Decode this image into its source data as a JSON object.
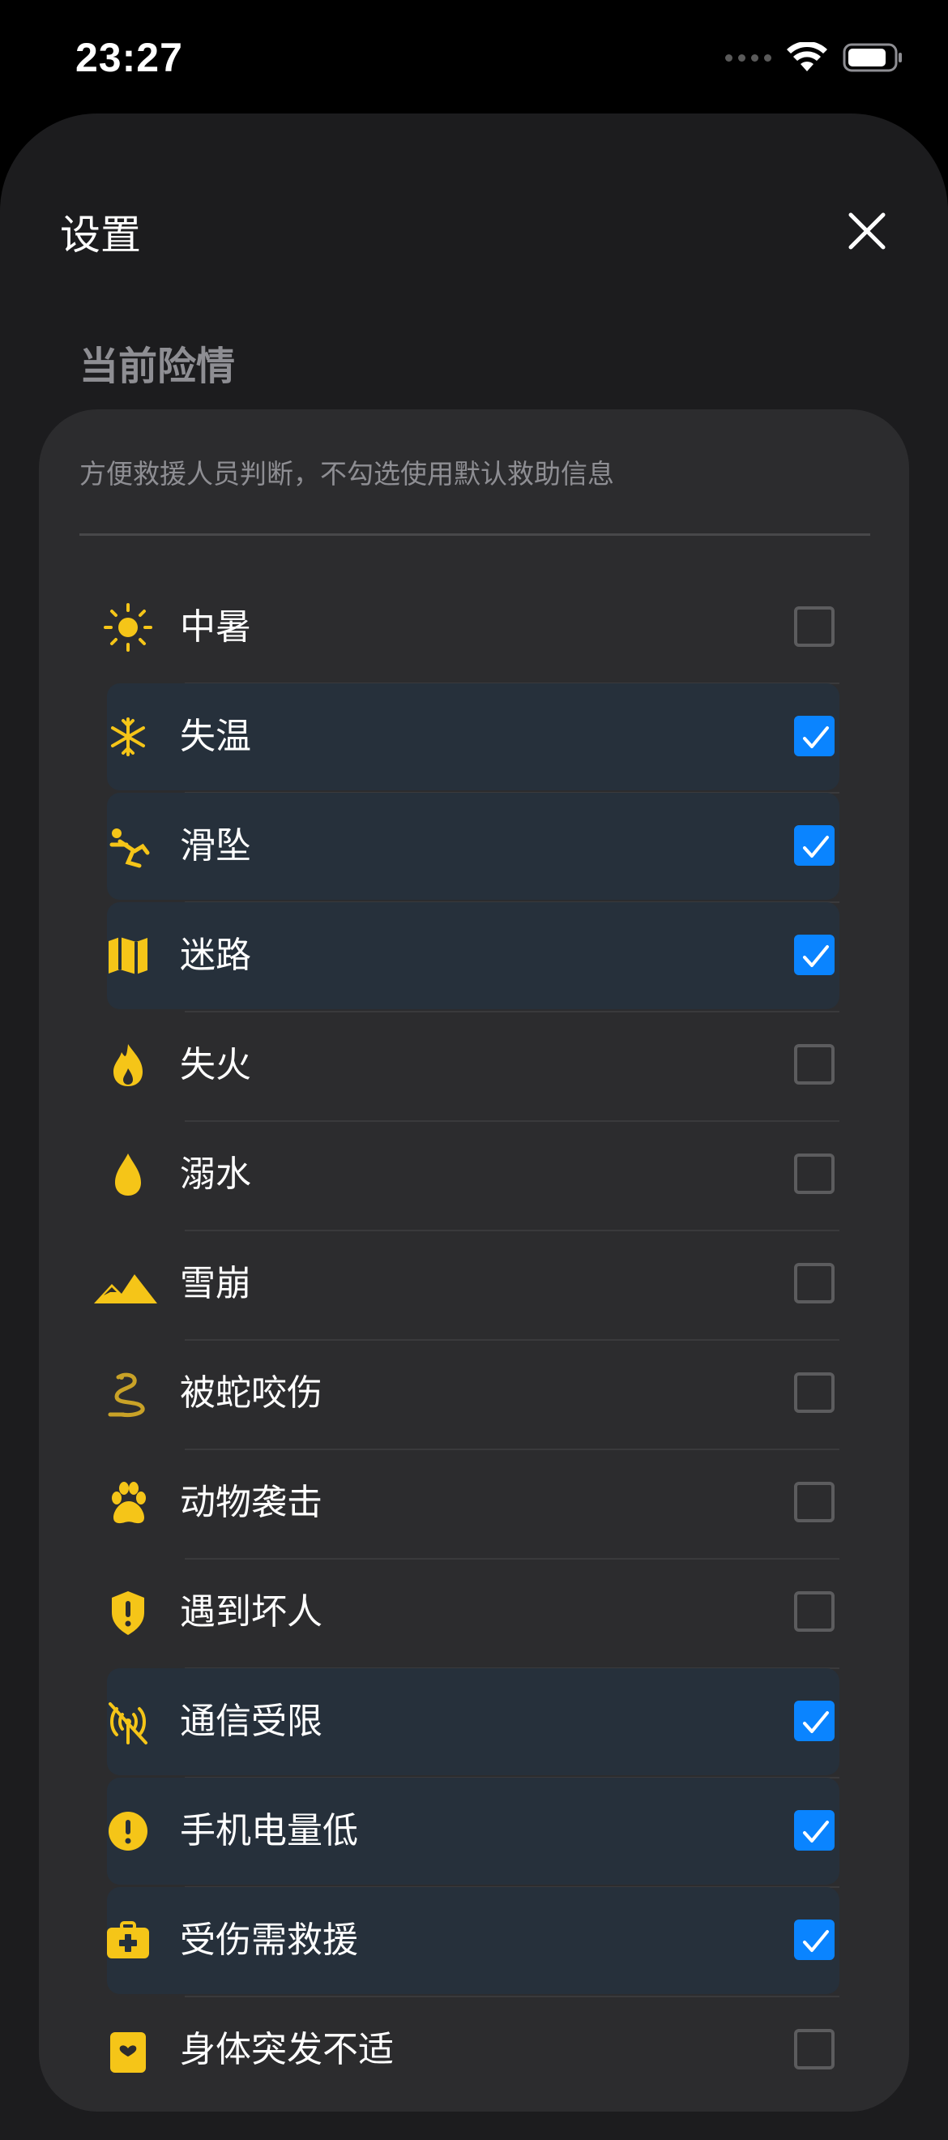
{
  "status_bar": {
    "time": "23:27"
  },
  "sheet": {
    "title": "设置",
    "section_title": "当前险情",
    "hint": "方便救援人员判断，不勾选使用默认救助信息"
  },
  "colors": {
    "accent": "#0a84ff",
    "icon": "#f5c518",
    "background": "#1c1c1e",
    "card": "#2c2c2e"
  },
  "items": [
    {
      "label": "中暑",
      "icon": "sun-icon",
      "checked": false
    },
    {
      "label": "失温",
      "icon": "snowflake-icon",
      "checked": true
    },
    {
      "label": "滑坠",
      "icon": "person-falling-icon",
      "checked": true
    },
    {
      "label": "迷路",
      "icon": "map-icon",
      "checked": true
    },
    {
      "label": "失火",
      "icon": "flame-icon",
      "checked": false
    },
    {
      "label": "溺水",
      "icon": "water-drop-icon",
      "checked": false
    },
    {
      "label": "雪崩",
      "icon": "mountain-icon",
      "checked": false
    },
    {
      "label": "被蛇咬伤",
      "icon": "snake-icon",
      "checked": false
    },
    {
      "label": "动物袭击",
      "icon": "paw-icon",
      "checked": false
    },
    {
      "label": "遇到坏人",
      "icon": "shield-alert-icon",
      "checked": false
    },
    {
      "label": "通信受限",
      "icon": "antenna-off-icon",
      "checked": true
    },
    {
      "label": "手机电量低",
      "icon": "alert-circle-icon",
      "checked": true
    },
    {
      "label": "受伤需救援",
      "icon": "medical-kit-icon",
      "checked": true
    },
    {
      "label": "身体突发不适",
      "icon": "health-card-icon",
      "checked": false
    }
  ]
}
